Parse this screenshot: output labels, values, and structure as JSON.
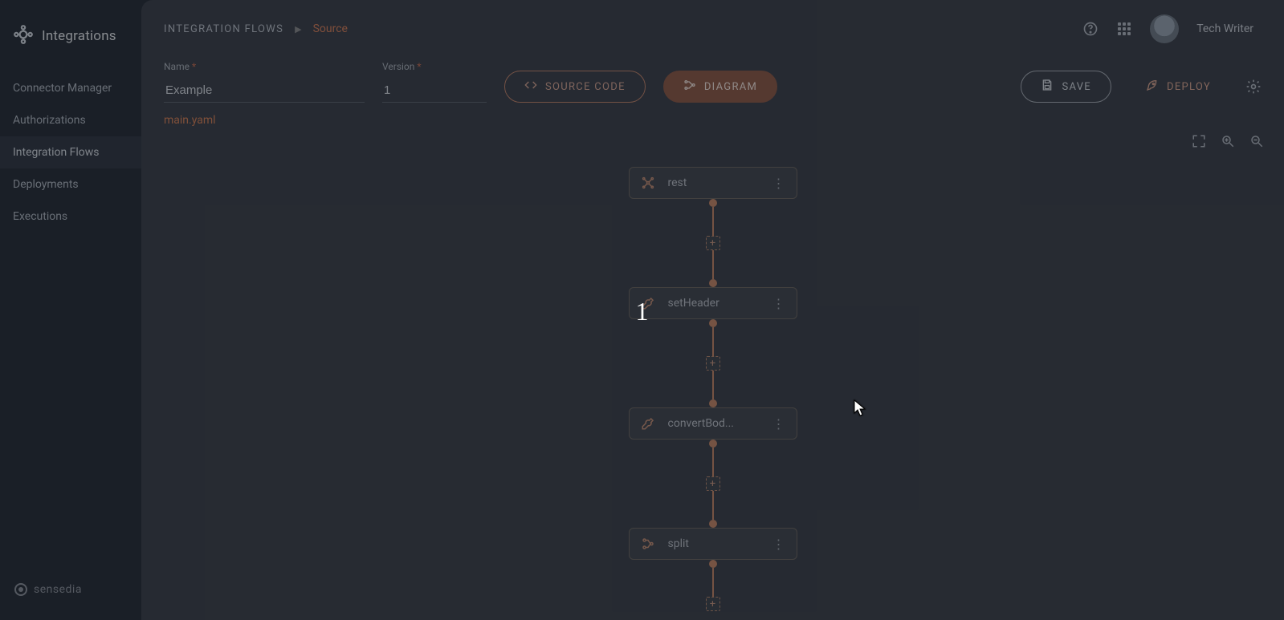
{
  "product": "Integrations",
  "sidebar": {
    "items": [
      {
        "label": "Connector Manager"
      },
      {
        "label": "Authorizations"
      },
      {
        "label": "Integration Flows"
      },
      {
        "label": "Deployments"
      },
      {
        "label": "Executions"
      }
    ],
    "footer_brand": "sensedia"
  },
  "breadcrumb": {
    "root": "INTEGRATION FLOWS",
    "current": "Source"
  },
  "user": {
    "name": "Tech Writer"
  },
  "fields": {
    "name": {
      "label": "Name",
      "value": "Example"
    },
    "version": {
      "label": "Version",
      "value": "1"
    }
  },
  "buttons": {
    "source_code": "SOURCE CODE",
    "diagram": "DIAGRAM",
    "save": "SAVE",
    "deploy": "DEPLOY"
  },
  "file_tab": "main.yaml",
  "flow": {
    "nodes": [
      {
        "label": "rest",
        "icon": "hub"
      },
      {
        "label": "setHeader",
        "icon": "wrench"
      },
      {
        "label": "convertBod...",
        "icon": "wrench"
      },
      {
        "label": "split",
        "icon": "branch"
      }
    ]
  },
  "overlay": {
    "big_text": "1"
  }
}
